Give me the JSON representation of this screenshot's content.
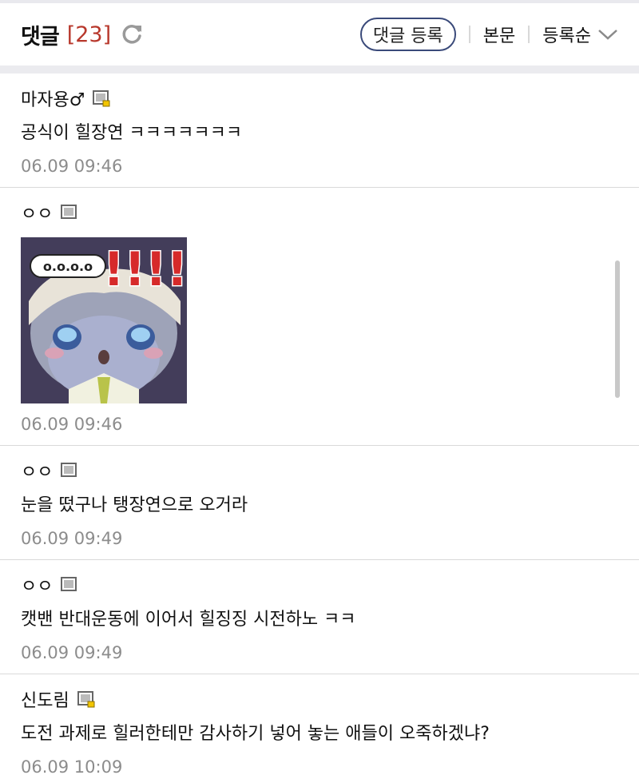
{
  "header": {
    "title": "댓글",
    "count": "[23]",
    "write_button": "댓글 등록",
    "body_link": "본문",
    "sort_label": "등록순"
  },
  "comments": [
    {
      "author": "마자용♂",
      "text": "공식이 힐장연 ㅋㅋㅋㅋㅋㅋㅋ",
      "time": "06.09 09:46",
      "level_icon": "member-level-icon-gold"
    },
    {
      "author": "ㅇㅇ",
      "sticker": {
        "caption": "o.o.o.o",
        "exclaim": "!!!!"
      },
      "time": "06.09 09:46",
      "level_icon": "member-level-icon"
    },
    {
      "author": "ㅇㅇ",
      "text": "눈을 떴구나 탱장연으로 오거라",
      "time": "06.09 09:49",
      "level_icon": "member-level-icon"
    },
    {
      "author": "ㅇㅇ",
      "text": "캣밴 반대운동에 이어서 힐징징 시전하노 ㅋㅋ",
      "time": "06.09 09:49",
      "level_icon": "member-level-icon"
    },
    {
      "author": "신도림",
      "text": "도전 과제로 힐러한테만 감사하기 넣어 놓는 애들이 오죽하겠냐?",
      "time": "06.09 10:09",
      "level_icon": "member-level-icon-gold"
    }
  ],
  "colors": {
    "count": "#b8382c",
    "button_border": "#3a4a7a",
    "time": "#8c8c8c"
  }
}
